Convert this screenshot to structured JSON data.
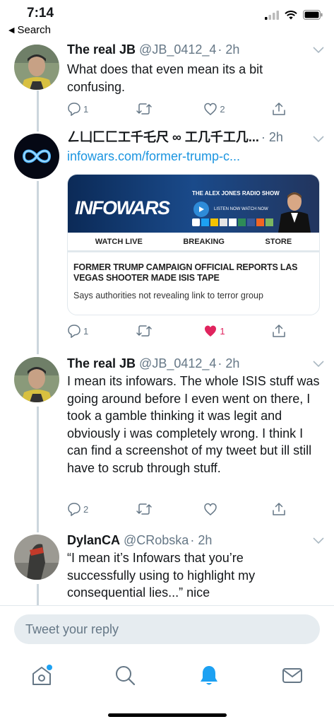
{
  "status_bar": {
    "time": "7:14",
    "back_label": "Search"
  },
  "tweets": [
    {
      "name": "The real JB",
      "handle": "@JB_0412_4",
      "time": "· 2h",
      "text": "What does that even mean its a bit confusing.",
      "reply_count": "1",
      "retweet_count": "",
      "like_count": "2",
      "liked": false
    },
    {
      "name": "ㄥ凵匚匚工千乇尺 ∞ 工几千工几...",
      "handle": "",
      "time": "· 2h",
      "link": "infowars.com/former-trump-c...",
      "card": {
        "brand": "INFOWARS",
        "show": "THE ALEX JONES RADIO SHOW",
        "listen": "LISTEN NOW",
        "watch": "WATCH NOW",
        "nav": [
          "WATCH LIVE",
          "BREAKING",
          "STORE"
        ],
        "headline": "FORMER TRUMP CAMPAIGN OFFICIAL REPORTS LAS VEGAS SHOOTER MADE ISIS TAPE",
        "subhead": "Says authorities not revealing link to terror group"
      },
      "reply_count": "1",
      "retweet_count": "",
      "like_count": "1",
      "liked": true
    },
    {
      "name": "The real JB",
      "handle": "@JB_0412_4",
      "time": "· 2h",
      "text": "I mean its infowars. The whole ISIS stuff was going around before I even went on there, I took a gamble thinking it was legit and obviously i was completely wrong. I think I can find a screenshot of my tweet but ill still have to scrub through stuff.",
      "reply_count": "2",
      "retweet_count": "",
      "like_count": "",
      "liked": false
    },
    {
      "name": "DylanCA",
      "handle": "@CRobska",
      "time": "· 2h",
      "text": "“I mean it’s Infowars that you’re successfully using to highlight my consequential lies...” nice"
    }
  ],
  "reply_bar": {
    "placeholder": "Tweet your reply"
  },
  "tabs": [
    "home-icon",
    "search-icon",
    "notifications-icon",
    "messages-icon"
  ],
  "colors": {
    "accent": "#1da1f2",
    "like": "#e0245e",
    "muted": "#657786"
  }
}
